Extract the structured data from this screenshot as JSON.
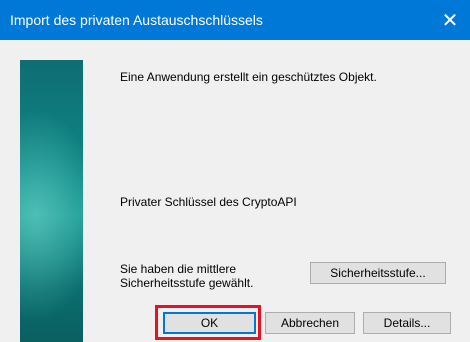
{
  "window": {
    "title": "Import des privaten Austauschschlüssels",
    "close_glyph": "✕"
  },
  "content": {
    "description": "Eine Anwendung erstellt ein geschütztes Objekt.",
    "key_label": "Privater Schlüssel des CryptoAPI",
    "security_text_line1": "Sie haben die mittlere",
    "security_text_line2": "Sicherheitsstufe gewählt."
  },
  "buttons": {
    "security_level": "Sicherheitsstufe...",
    "ok": "OK",
    "cancel": "Abbrechen",
    "details": "Details..."
  },
  "colors": {
    "titlebar": "#0078d7",
    "highlight": "#e81123"
  }
}
